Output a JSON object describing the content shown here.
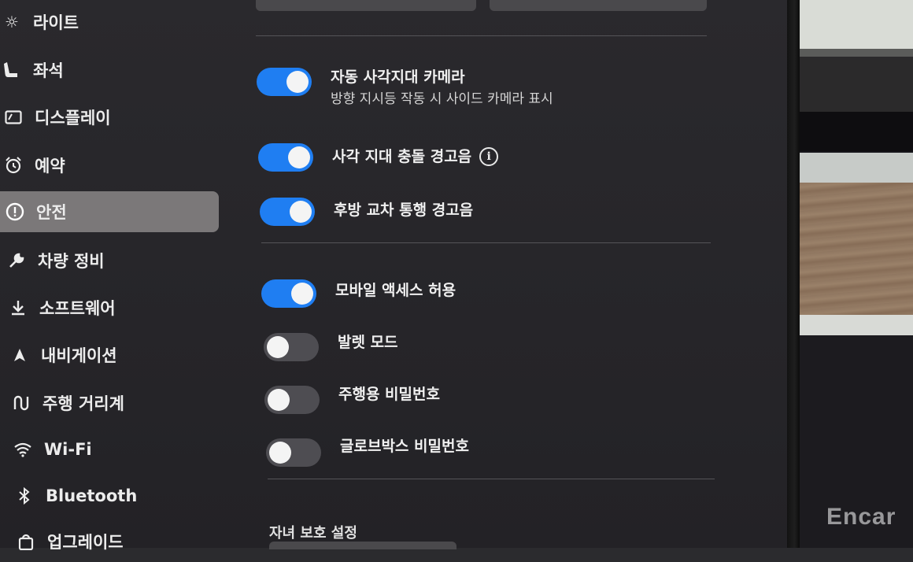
{
  "sidebar": {
    "items": [
      {
        "label": "라이트",
        "icon": "sun-icon"
      },
      {
        "label": "좌석",
        "icon": "seat-icon"
      },
      {
        "label": "디스플레이",
        "icon": "display-icon"
      },
      {
        "label": "예약",
        "icon": "alarm-clock-icon"
      },
      {
        "label": "안전",
        "icon": "alert-circle-icon",
        "active": true
      },
      {
        "label": "차량 정비",
        "icon": "wrench-icon"
      },
      {
        "label": "소프트웨어",
        "icon": "download-icon"
      },
      {
        "label": "내비게이션",
        "icon": "navigation-arrow-icon"
      },
      {
        "label": "주행 거리계",
        "icon": "trip-odometer-icon"
      },
      {
        "label": "Wi-Fi",
        "icon": "wifi-icon"
      },
      {
        "label": "Bluetooth",
        "icon": "bluetooth-icon"
      },
      {
        "label": "업그레이드",
        "icon": "shopping-bag-icon"
      }
    ]
  },
  "settings": {
    "auto_blind_spot_camera": {
      "title": "자동 사각지대 카메라",
      "subtitle": "방향 지시등 작동 시 사이드 카메라 표시",
      "enabled": true
    },
    "blind_spot_chime": {
      "title": "사각 지대 충돌 경고음",
      "enabled": true,
      "info_icon": "info-icon"
    },
    "rear_cross_traffic_chime": {
      "title": "후방 교차 통행 경고음",
      "enabled": true
    },
    "mobile_access": {
      "title": "모바일 액세스 허용",
      "enabled": true
    },
    "valet_mode": {
      "title": "발렛 모드",
      "enabled": false
    },
    "pin_to_drive": {
      "title": "주행용 비밀번호",
      "enabled": false
    },
    "glovebox_pin": {
      "title": "글로브박스 비밀번호",
      "enabled": false
    }
  },
  "child_protection": {
    "title": "자녀 보호 설정"
  },
  "watermark": "Encar",
  "colors": {
    "accent": "#1f7ef2",
    "active_nav": "#7b7879",
    "background": "#2a292d"
  }
}
